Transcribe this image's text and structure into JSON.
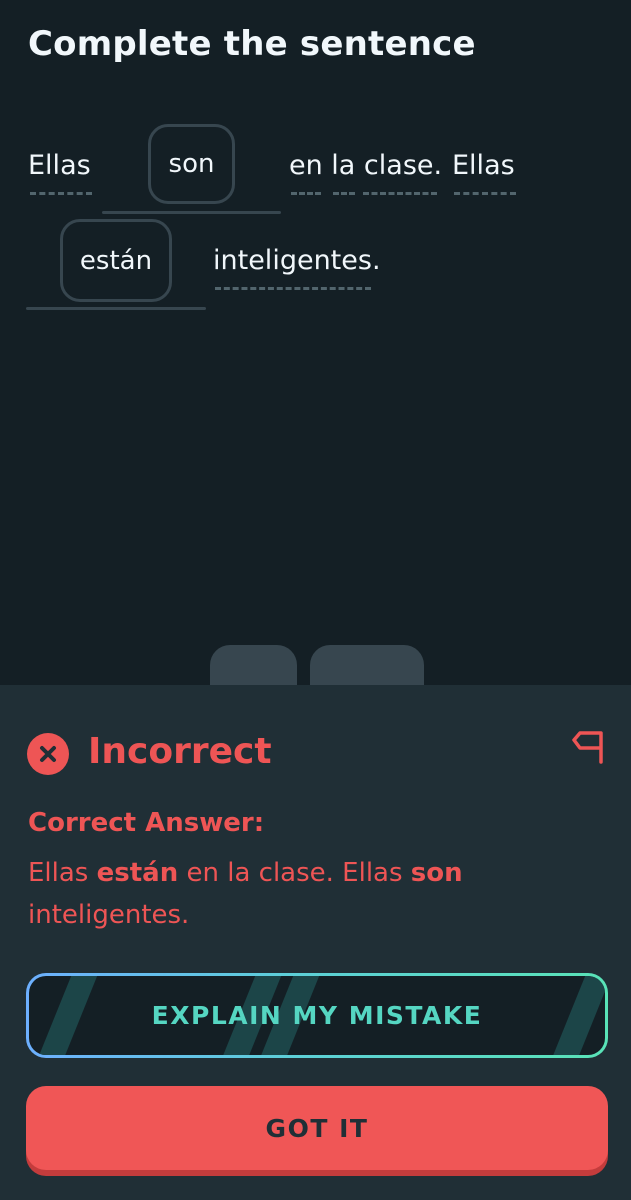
{
  "header": {
    "title": "Complete the sentence"
  },
  "sentence": {
    "words": [
      "Ellas",
      "en la clase.",
      "Ellas",
      "inteligentes."
    ],
    "filled": [
      "son",
      "están"
    ]
  },
  "feedback": {
    "status": "Incorrect",
    "answer_label": "Correct Answer:",
    "answer_parts": {
      "p1": "Ellas ",
      "b1": "están",
      "p2": " en la clase. Ellas ",
      "b2": "son",
      "p3": " inteligentes."
    }
  },
  "buttons": {
    "explain": "EXPLAIN MY MISTAKE",
    "got_it": "GOT IT"
  },
  "icons": {
    "status": "close-icon",
    "report": "flag-icon"
  },
  "colors": {
    "background": "#141f25",
    "sheet": "#202f36",
    "error": "#ee5555",
    "accent_teal": "#55d6c2",
    "tile": "#37464f"
  }
}
